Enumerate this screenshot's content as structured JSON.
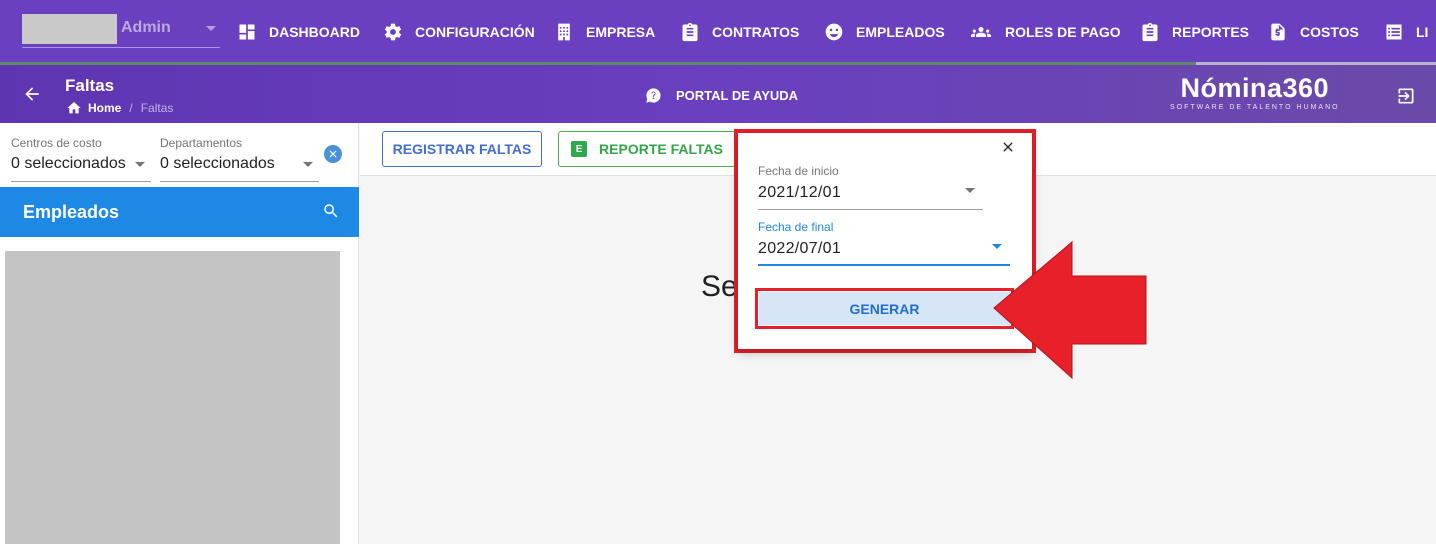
{
  "topnav": {
    "user_role": "Admin",
    "items": [
      {
        "label": "DASHBOARD",
        "icon": "dashboard-icon"
      },
      {
        "label": "CONFIGURACIÓN",
        "icon": "gear-icon"
      },
      {
        "label": "EMPRESA",
        "icon": "building-icon"
      },
      {
        "label": "CONTRATOS",
        "icon": "clipboard-icon"
      },
      {
        "label": "EMPLEADOS",
        "icon": "face-icon"
      },
      {
        "label": "ROLES DE PAGO",
        "icon": "people-icon"
      },
      {
        "label": "REPORTES",
        "icon": "clipboard-list-icon"
      },
      {
        "label": "COSTOS",
        "icon": "invoice-icon"
      },
      {
        "label": "LI",
        "icon": "list-icon"
      }
    ]
  },
  "subheader": {
    "title": "Faltas",
    "breadcrumb_home": "Home",
    "breadcrumb_sep": "/",
    "breadcrumb_current": "Faltas",
    "help_label": "PORTAL DE AYUDA",
    "brand_name": "Nómina360",
    "brand_tagline": "SOFTWARE DE TALENTO HUMANO"
  },
  "filters": {
    "cost_centers": {
      "label": "Centros de costo",
      "value": "0 seleccionados"
    },
    "departments": {
      "label": "Departamentos",
      "value": "0 seleccionados"
    }
  },
  "employees": {
    "title": "Empleados"
  },
  "toolbar": {
    "register_label": "REGISTRAR FALTAS",
    "report_label": "REPORTE FALTAS",
    "report_badge": "E"
  },
  "main": {
    "message": "Se"
  },
  "dialog": {
    "start_label": "Fecha de inicio",
    "start_value": "2021/12/01",
    "end_label": "Fecha de final",
    "end_value": "2022/07/01",
    "generate_label": "GENERAR"
  },
  "colors": {
    "nav_bg": "#6a3fc0",
    "accent_blue": "#1e88e5",
    "excel_green": "#2eaa4a",
    "annotation_red": "#e8202a"
  }
}
